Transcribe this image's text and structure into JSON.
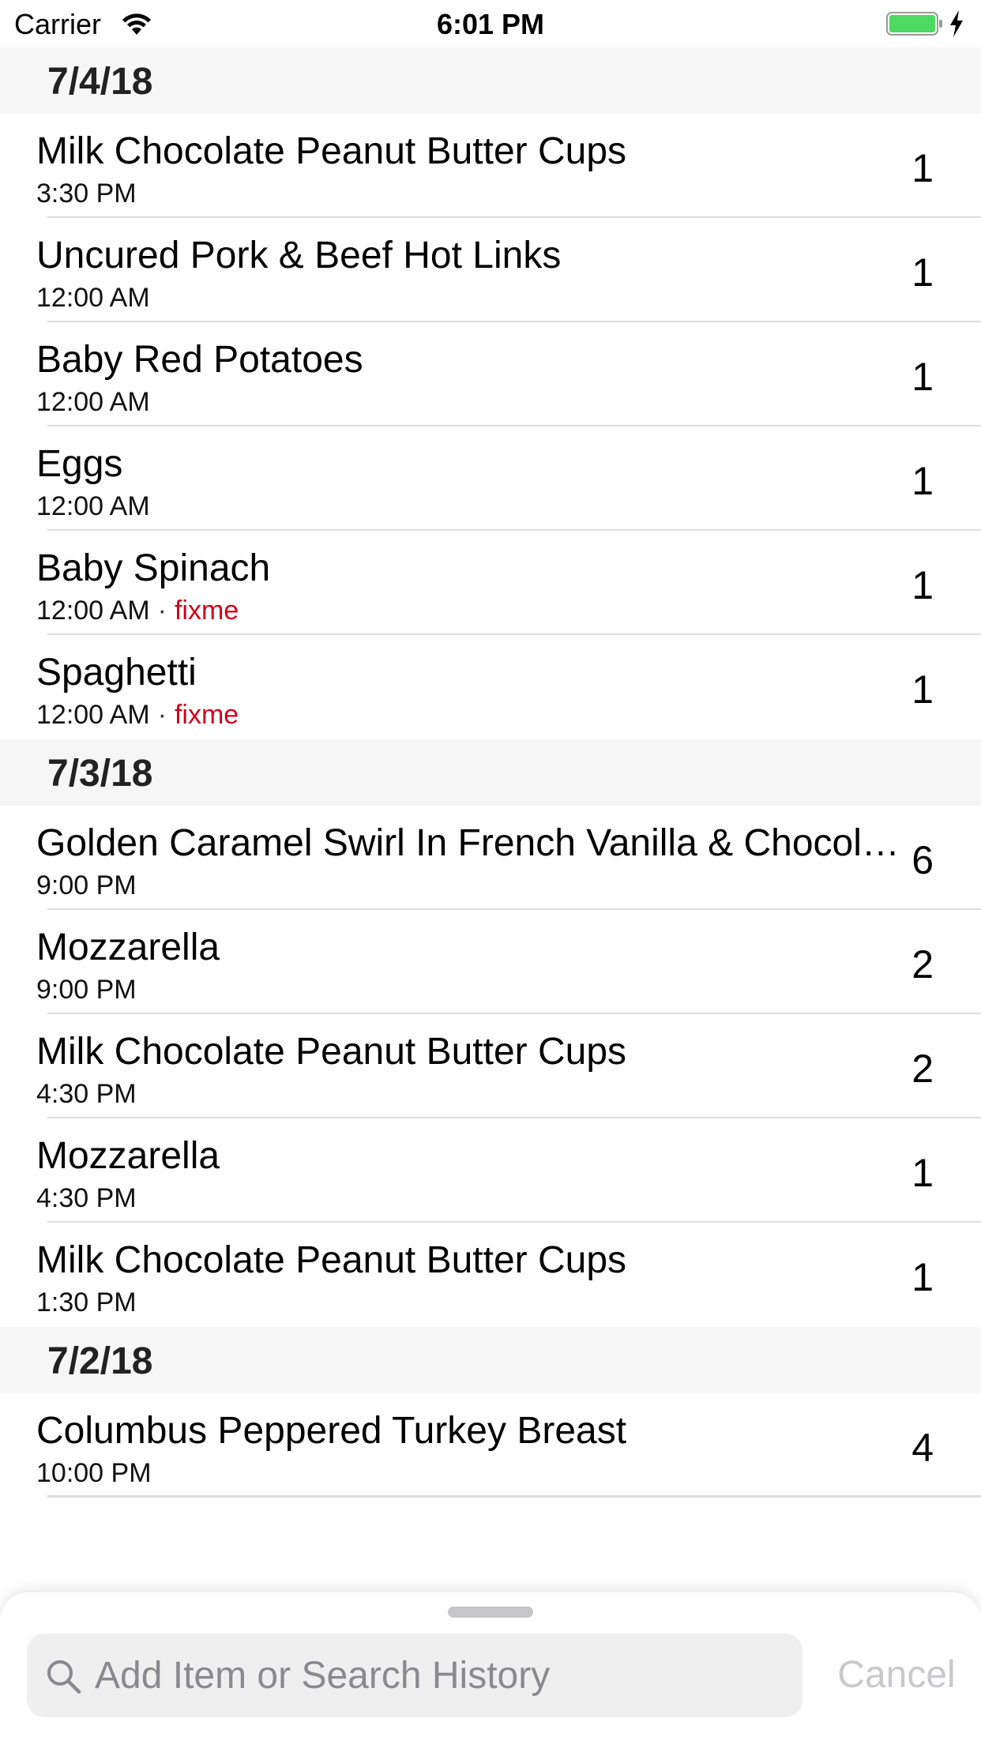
{
  "status_bar": {
    "carrier": "Carrier",
    "time": "6:01 PM",
    "battery_color": "#4cd964",
    "icons": [
      "wifi-icon",
      "battery-icon",
      "charging-bolt-icon"
    ]
  },
  "sections": [
    {
      "date": "7/4/18",
      "items": [
        {
          "name": "Milk Chocolate Peanut Butter Cups",
          "time": "3:30 PM",
          "count": "1"
        },
        {
          "name": "Uncured Pork & Beef Hot Links",
          "time": "12:00 AM",
          "count": "1"
        },
        {
          "name": "Baby Red Potatoes",
          "time": "12:00 AM",
          "count": "1"
        },
        {
          "name": "Eggs",
          "time": "12:00 AM",
          "count": "1"
        },
        {
          "name": "Baby Spinach",
          "time": "12:00 AM",
          "flag": "fixme",
          "count": "1"
        },
        {
          "name": "Spaghetti",
          "time": "12:00 AM",
          "flag": "fixme",
          "count": "1"
        }
      ]
    },
    {
      "date": "7/3/18",
      "items": [
        {
          "name": "Golden Caramel Swirl In French Vanilla & Chocolate",
          "time": "9:00 PM",
          "count": "6"
        },
        {
          "name": "Mozzarella",
          "time": "9:00 PM",
          "count": "2"
        },
        {
          "name": "Milk Chocolate Peanut Butter Cups",
          "time": "4:30 PM",
          "count": "2"
        },
        {
          "name": "Mozzarella",
          "time": "4:30 PM",
          "count": "1"
        },
        {
          "name": "Milk Chocolate Peanut Butter Cups",
          "time": "1:30 PM",
          "count": "1"
        }
      ]
    },
    {
      "date": "7/2/18",
      "items": [
        {
          "name": "Columbus Peppered Turkey Breast",
          "time": "10:00 PM",
          "count": "4"
        }
      ]
    }
  ],
  "flag_separator": "·",
  "flag_color": "#d0021b",
  "search": {
    "placeholder": "Add Item or Search History",
    "value": "",
    "cancel_label": "Cancel"
  }
}
